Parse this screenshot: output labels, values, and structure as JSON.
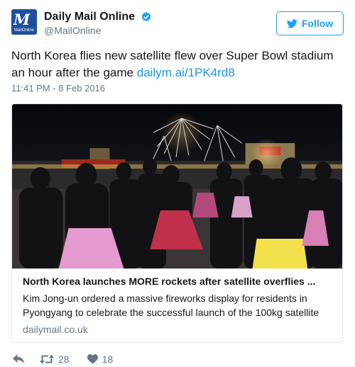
{
  "account": {
    "avatar_text_top": "M",
    "avatar_text_bottom": "MailOnline",
    "display_name": "Daily Mail Online",
    "handle": "@MailOnline",
    "verified": true
  },
  "follow_button": {
    "label": "Follow",
    "icon": "twitter-bird-icon"
  },
  "tweet": {
    "text": "North Korea flies new satellite flew over Super Bowl stadium an hour after the game ",
    "link": "dailym.ai/1PK4rd8",
    "timestamp": "11:41 PM - 8 Feb 2016"
  },
  "card": {
    "image_description": "crowd-watching-fireworks",
    "title": "North Korea launches MORE rockets after satellite overflies ...",
    "description": "Kim Jong-un ordered a massive fireworks display for residents in Pyongyang to celebrate the successful launch of the 100kg satellite",
    "domain": "dailymail.co.uk"
  },
  "actions": {
    "reply_icon": "reply-icon",
    "retweet_icon": "retweet-icon",
    "retweet_count": "28",
    "like_icon": "heart-icon",
    "like_count": "18"
  },
  "colors": {
    "accent": "#1da1f2",
    "link": "#1b95e0",
    "muted": "#657786",
    "avatar_bg": "#1f4f9c"
  }
}
